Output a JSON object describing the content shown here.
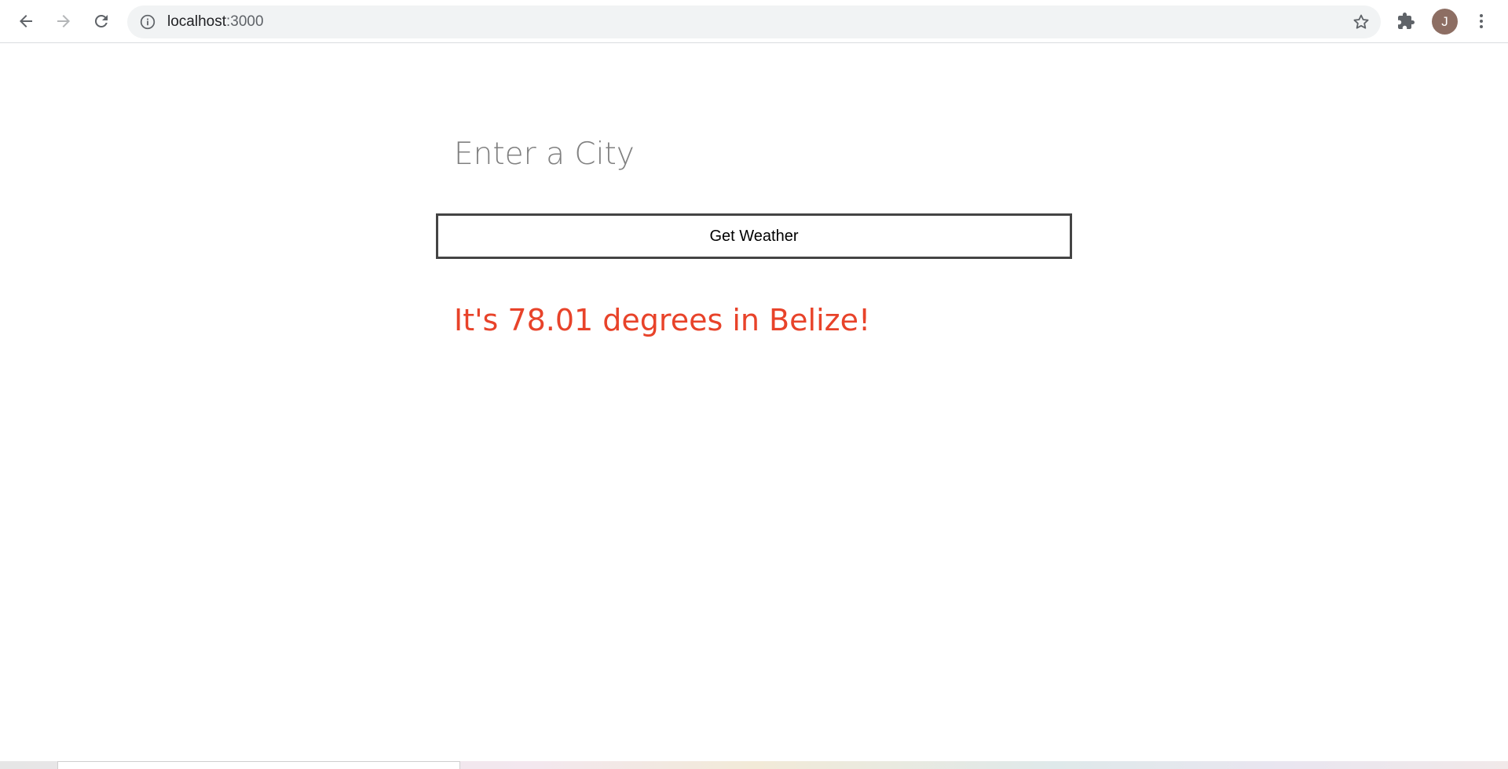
{
  "browser": {
    "url_host": "localhost",
    "url_port": ":3000",
    "profile_initial": "J",
    "avatar_color": "#8d6e63",
    "icons": {
      "back": "back-arrow-icon",
      "forward": "forward-arrow-icon",
      "reload": "reload-icon",
      "site_info": "info-icon",
      "bookmark": "star-icon",
      "extensions": "puzzle-icon",
      "menu": "kebab-menu-icon"
    }
  },
  "page": {
    "city_placeholder": "Enter a City",
    "city_value": "",
    "button_label": "Get Weather",
    "result_text": "It's 78.01 degrees in Belize!",
    "result_color": "#e8432a"
  }
}
